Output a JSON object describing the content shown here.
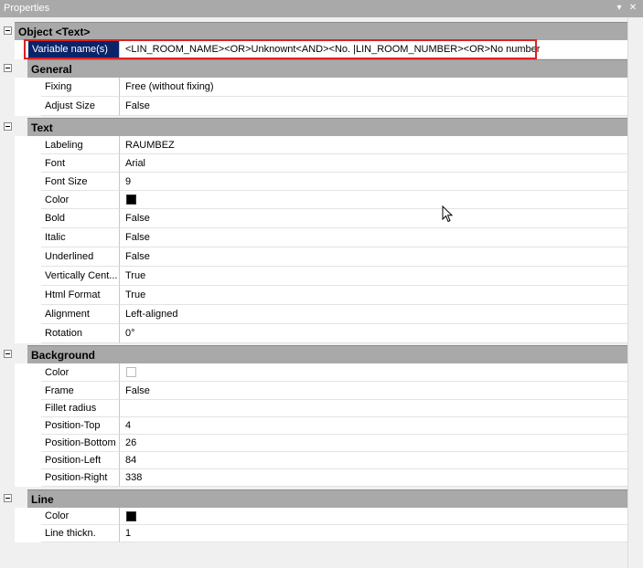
{
  "window": {
    "title": "Properties",
    "buttons": {
      "pin": "▾",
      "pin2": "▴",
      "close": "✕"
    }
  },
  "colors": {
    "selection": "#0a246a",
    "highlight": "#e02020",
    "category": "#a9a9a9"
  },
  "categories": [
    {
      "label": "Object <Text>",
      "rows": [
        {
          "name": "Variable name(s)",
          "value": "<LIN_ROOM_NAME><OR>Unknownt<AND><No. |LIN_ROOM_NUMBER><OR>No number"
        }
      ]
    },
    {
      "label": "General",
      "rows": [
        {
          "name": "Fixing",
          "value": "Free (without fixing)"
        },
        {
          "name": "Adjust Size",
          "value": "False"
        }
      ]
    },
    {
      "label": "Text",
      "rows": [
        {
          "name": "Labeling",
          "value": "RAUMBEZ"
        },
        {
          "name": "Font",
          "value": "Arial"
        },
        {
          "name": "Font Size",
          "value": "9"
        },
        {
          "name": "Color",
          "value": "",
          "swatch": "#000000"
        },
        {
          "name": "Bold",
          "value": "False"
        },
        {
          "name": "Italic",
          "value": "False"
        },
        {
          "name": "Underlined",
          "value": "False"
        },
        {
          "name": "Vertically Cent...",
          "value": "True"
        },
        {
          "name": "Html Format",
          "value": "True"
        },
        {
          "name": "Alignment",
          "value": "Left-aligned"
        },
        {
          "name": "Rotation",
          "value": "0°"
        }
      ]
    },
    {
      "label": "Background",
      "rows": [
        {
          "name": "Color",
          "value": "",
          "swatch": "#ffffff"
        },
        {
          "name": "Frame",
          "value": "False"
        },
        {
          "name": "Fillet radius",
          "value": ""
        },
        {
          "name": "Position-Top",
          "value": "4"
        },
        {
          "name": "Position-Bottom",
          "value": "26"
        },
        {
          "name": "Position-Left",
          "value": "84"
        },
        {
          "name": "Position-Right",
          "value": "338"
        }
      ]
    },
    {
      "label": "Line",
      "rows": [
        {
          "name": "Color",
          "value": "",
          "swatch": "#000000"
        },
        {
          "name": "Line thickn.",
          "value": "1"
        }
      ]
    }
  ]
}
